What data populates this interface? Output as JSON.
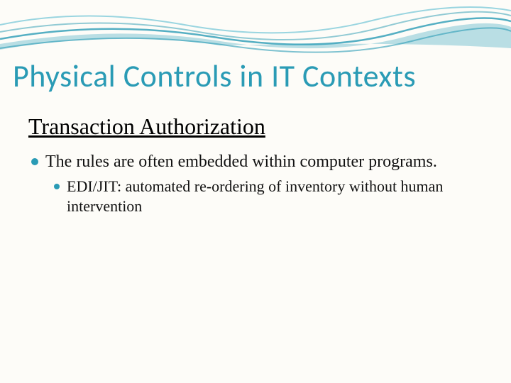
{
  "slide": {
    "title": "Physical Controls in IT Contexts",
    "subtitle": "Transaction Authorization",
    "bullets": {
      "l1": "The rules are often embedded within computer programs.",
      "l2": "EDI/JIT: automated re-ordering of inventory without human intervention"
    }
  }
}
